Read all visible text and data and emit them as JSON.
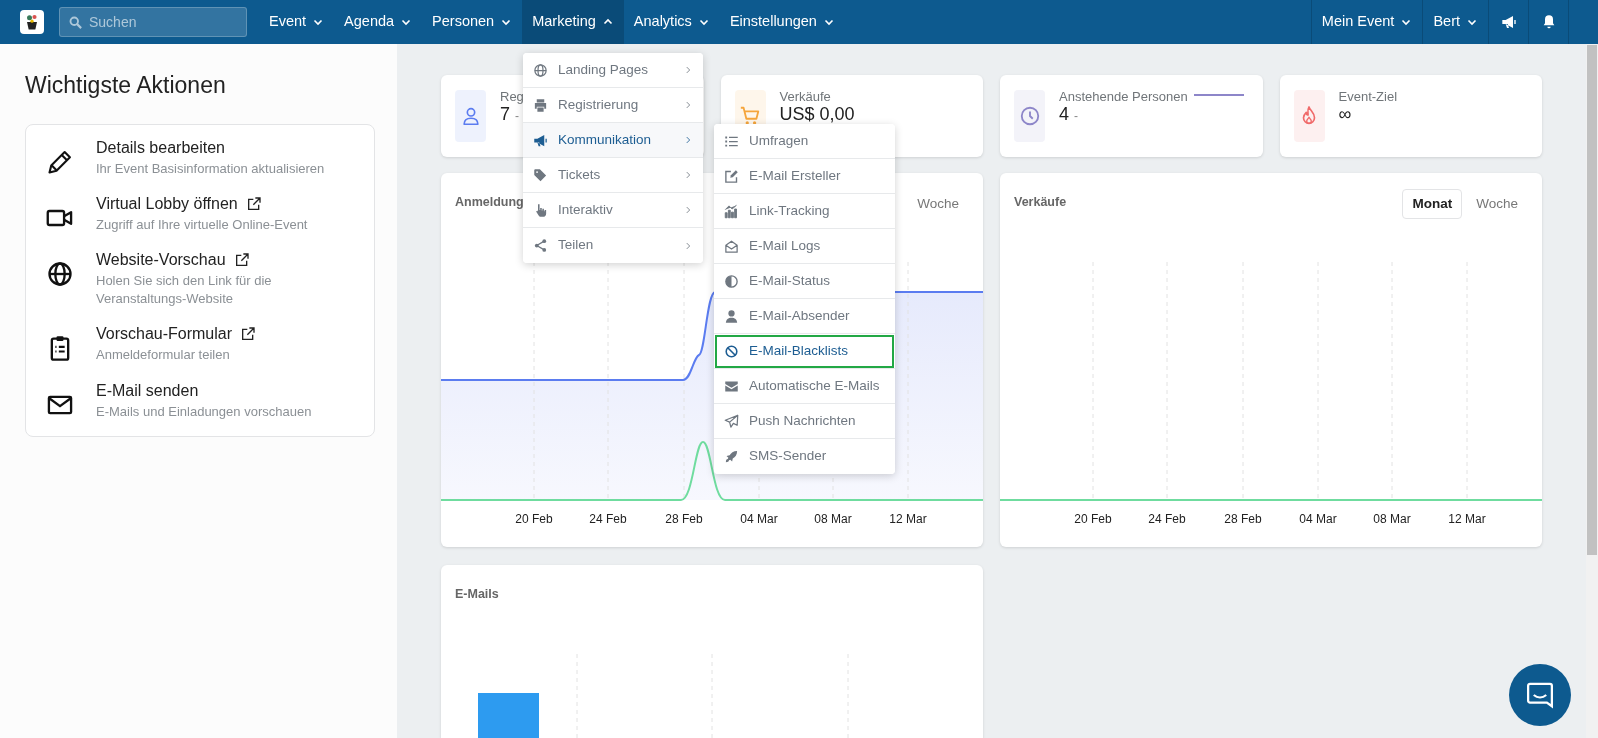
{
  "navbar": {
    "search": {
      "placeholder": "Suchen"
    },
    "menus": [
      {
        "label": "Event",
        "expanded": false
      },
      {
        "label": "Agenda",
        "expanded": false
      },
      {
        "label": "Personen",
        "expanded": false
      },
      {
        "label": "Marketing",
        "expanded": true
      },
      {
        "label": "Analytics",
        "expanded": false
      },
      {
        "label": "Einstellungen",
        "expanded": false
      }
    ],
    "user_menus": [
      {
        "label": "Mein Event"
      },
      {
        "label": "Bert"
      }
    ]
  },
  "sidebar": {
    "title": "Wichtigste Aktionen",
    "actions": [
      {
        "title": "Details bearbeiten",
        "subtitle": "Ihr Event Basisinformation aktualisieren",
        "external": false
      },
      {
        "title": "Virtual Lobby öffnen",
        "subtitle": "Zugriff auf Ihre virtuelle Online-Event",
        "external": true
      },
      {
        "title": "Website-Vorschau",
        "subtitle": "Holen Sie sich den Link für die Veranstaltungs-Website",
        "external": true
      },
      {
        "title": "Vorschau-Formular",
        "subtitle": "Anmeldeformular teilen",
        "external": true
      },
      {
        "title": "E-Mail senden",
        "subtitle": "E-Mails und Einladungen vorschauen",
        "external": false
      }
    ]
  },
  "stats": [
    {
      "label": "Reg",
      "value": "7",
      "trend": "-",
      "color": "#5b7cf0"
    },
    {
      "label": "Verkäufe",
      "value": "US$ 0,00",
      "color": "#f5a53c"
    },
    {
      "label": "Anstehende Personen",
      "value": "4",
      "trend": "-",
      "color": "#8d86c9"
    },
    {
      "label": "Event-Ziel",
      "value": "∞",
      "color": "#f06a6a"
    }
  ],
  "charts": [
    {
      "title": "Anmeldung",
      "periods": [
        {
          "label": "Woche",
          "selected": false
        }
      ],
      "x_labels": [
        "20 Feb",
        "24 Feb",
        "28 Feb",
        "04 Mar",
        "08 Mar",
        "12 Mar"
      ]
    },
    {
      "title": "Verkäufe",
      "periods": [
        {
          "label": "Monat",
          "selected": true
        },
        {
          "label": "Woche",
          "selected": false
        }
      ],
      "x_labels": [
        "20 Feb",
        "24 Feb",
        "28 Feb",
        "04 Mar",
        "08 Mar",
        "12 Mar"
      ]
    }
  ],
  "emails_chart": {
    "title": "E-Mails"
  },
  "marketing_menu": {
    "items": [
      {
        "label": "Landing Pages",
        "selected": false
      },
      {
        "label": "Registrierung",
        "selected": false
      },
      {
        "label": "Kommunikation",
        "selected": true
      },
      {
        "label": "Tickets",
        "selected": false
      },
      {
        "label": "Interaktiv",
        "selected": false
      },
      {
        "label": "Teilen",
        "selected": false
      }
    ],
    "submenu": {
      "items": [
        {
          "label": "Umfragen",
          "selected": false
        },
        {
          "label": "E-Mail Ersteller",
          "selected": false
        },
        {
          "label": "Link-Tracking",
          "selected": false
        },
        {
          "label": "E-Mail Logs",
          "selected": false
        },
        {
          "label": "E-Mail-Status",
          "selected": false
        },
        {
          "label": "E-Mail-Absender",
          "selected": false
        },
        {
          "label": "E-Mail-Blacklists",
          "selected": true
        },
        {
          "label": "Automatische E-Mails",
          "selected": false
        },
        {
          "label": "Push Nachrichten",
          "selected": false
        },
        {
          "label": "SMS-Sender",
          "selected": false
        }
      ]
    }
  }
}
